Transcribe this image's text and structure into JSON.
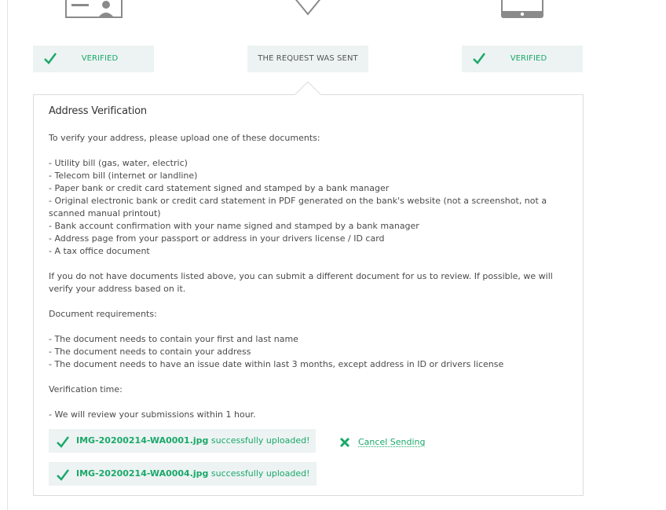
{
  "colors": {
    "accent": "#1ba86a",
    "status_bg": "#edf3f3",
    "icon_gray": "#8a8a8a"
  },
  "steps": [
    {
      "icon": "id-card-icon",
      "status": "VERIFIED"
    },
    {
      "icon": "location-pin-icon",
      "status": "THE REQUEST WAS SENT"
    },
    {
      "icon": "phone-icon",
      "status": "VERIFIED"
    }
  ],
  "panel": {
    "title": "Address Verification",
    "intro": "To verify your address, please upload one of these documents:",
    "documents": [
      "- Utility bill (gas, water, electric)",
      "- Telecom bill (internet or landline)",
      "- Paper bank or credit card statement signed and stamped by a bank manager",
      "- Original electronic bank or credit card statement in PDF generated on the bank's website (not a screenshot, not a scanned manual printout)",
      "- Bank account confirmation with your name signed and stamped by a bank manager",
      "- Address page from your passport or address in your drivers license / ID card",
      "- A tax office document"
    ],
    "alternative": "If you do not have documents listed above, you can submit a different document for us to review. If possible, we will verify your address based on it.",
    "requirements_title": "Document requirements:",
    "requirements": [
      "- The document needs to contain your first and last name",
      "- The document needs to contain your address",
      "- The document needs to have an issue date within last 3 months, except address in ID or drivers license"
    ],
    "time_title": "Verification time:",
    "time_text": "- We will review your submissions within 1 hour."
  },
  "uploads": [
    {
      "filename": "IMG-20200214-WA0001.jpg",
      "message": " successfully uploaded!"
    },
    {
      "filename": "IMG-20200214-WA0004.jpg",
      "message": " successfully uploaded!"
    }
  ],
  "cancel_label": "Cancel Sending"
}
